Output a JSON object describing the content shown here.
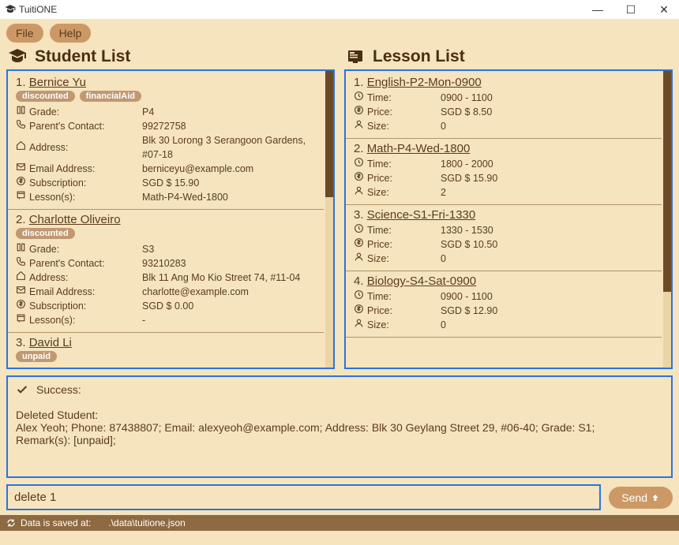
{
  "app": {
    "title": "TuitiONE"
  },
  "menu": {
    "file": "File",
    "help": "Help"
  },
  "panel_student": "Student List",
  "panel_lesson": "Lesson List",
  "labels": {
    "grade": "Grade:",
    "parent": "Parent's Contact:",
    "address": "Address:",
    "email": "Email Address:",
    "subscription": "Subscription:",
    "lessons": "Lesson(s):",
    "time": "Time:",
    "price": "Price:",
    "size": "Size:"
  },
  "students": [
    {
      "idx": "1.",
      "name": "Bernice Yu",
      "tags": [
        "discounted",
        "financialAid"
      ],
      "grade": "P4",
      "parent": "99272758",
      "address": "Blk 30 Lorong 3 Serangoon Gardens, #07-18",
      "email": "berniceyu@example.com",
      "subscription": "SGD $ 15.90",
      "lessons": "Math-P4-Wed-1800"
    },
    {
      "idx": "2.",
      "name": "Charlotte Oliveiro",
      "tags": [
        "discounted"
      ],
      "grade": "S3",
      "parent": "93210283",
      "address": "Blk 11 Ang Mo Kio Street 74, #11-04",
      "email": "charlotte@example.com",
      "subscription": "SGD $ 0.00",
      "lessons": "-"
    },
    {
      "idx": "3.",
      "name": "David Li",
      "tags": [
        "unpaid"
      ],
      "grade": "",
      "parent": "",
      "address": "",
      "email": "",
      "subscription": "",
      "lessons": ""
    }
  ],
  "lessons": [
    {
      "idx": "1.",
      "name": "English-P2-Mon-0900",
      "time": "0900 - 1100",
      "price": "SGD $ 8.50",
      "size": "0"
    },
    {
      "idx": "2.",
      "name": "Math-P4-Wed-1800",
      "time": "1800 - 2000",
      "price": "SGD $ 15.90",
      "size": "2"
    },
    {
      "idx": "3.",
      "name": "Science-S1-Fri-1330",
      "time": "1330 - 1530",
      "price": "SGD $ 10.50",
      "size": "0"
    },
    {
      "idx": "4.",
      "name": "Biology-S4-Sat-0900",
      "time": "0900 - 1100",
      "price": "SGD $ 12.90",
      "size": "0"
    }
  ],
  "result": {
    "status": "Success:",
    "line1": "Deleted Student:",
    "line2": "Alex Yeoh; Phone: 87438807; Email: alexyeoh@example.com; Address: Blk 30 Geylang Street 29, #06-40; Grade: S1;",
    "line3": "Remark(s): [unpaid];"
  },
  "command": {
    "value": "delete 1",
    "send": "Send"
  },
  "status": {
    "label": "Data is saved at:",
    "path": ".\\data\\tuitione.json"
  }
}
